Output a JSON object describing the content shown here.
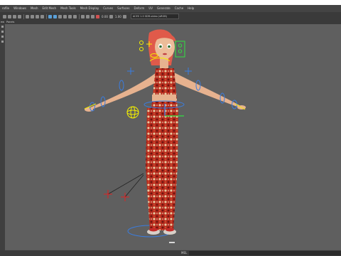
{
  "menubar": {
    "items": [
      "rofile",
      "Windows",
      "Mesh",
      "Edit Mesh",
      "Mesh Tools",
      "Mesh Display",
      "Curves",
      "Surfaces",
      "Deform",
      "UV",
      "Generate",
      "Cache",
      "Help"
    ]
  },
  "toolbar": {
    "value1": "0.00",
    "value2": "1.00",
    "colorspace": "ACES 1.0 SDR-video (sRGB)"
  },
  "panel": {
    "menu1": "ew",
    "menu2": "Panels"
  },
  "status": {
    "mel_label": "MEL"
  },
  "colors": {
    "viewport_bg": "#5f5f5f",
    "rig_blue": "#3a7de0",
    "rig_yellow": "#f4f000",
    "rig_green": "#30e040",
    "rig_red": "#ff2020",
    "dress_red": "#b5281e"
  }
}
